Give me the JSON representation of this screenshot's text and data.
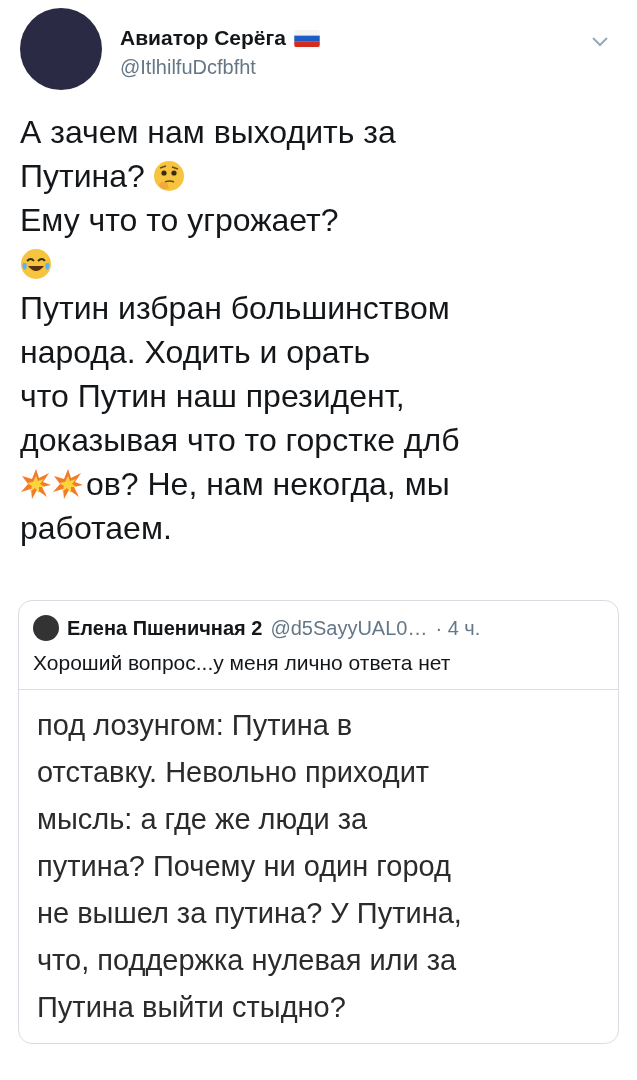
{
  "author": {
    "name": "Авиатор Серёга",
    "handle": "@ItlhilfuDcfbfht"
  },
  "body": [
    [
      {
        "kind": "text",
        "text": "А зачем нам выходить за"
      }
    ],
    [
      {
        "kind": "text",
        "text": "Путина?"
      },
      {
        "kind": "thinking"
      }
    ],
    [
      {
        "kind": "text",
        "text": "Ему что то угрожает?"
      }
    ],
    [
      {
        "kind": "joy"
      }
    ],
    [
      {
        "kind": "text",
        "text": "Путин избран большинством"
      }
    ],
    [
      {
        "kind": "text",
        "text": "народа. Ходить и орать"
      }
    ],
    [
      {
        "kind": "text",
        "text": "что Путин наш президент,"
      }
    ],
    [
      {
        "kind": "text",
        "text": "доказывая что то горстке длб"
      }
    ],
    [
      {
        "kind": "collision"
      },
      {
        "kind": "collision"
      },
      {
        "kind": "text",
        "text": "ов? Не, нам некогда, мы"
      }
    ],
    [
      {
        "kind": "text",
        "text": "работаем."
      }
    ]
  ],
  "quote": {
    "name": "Елена Пшеничная 2",
    "handle": "@d5SayyUAL0…",
    "time": "· 4 ч.",
    "text": "Хороший вопрос...у меня лично ответа нет",
    "image_lines": [
      "под лозунгом: Путина в",
      "отставку. Невольно приходит",
      "мысль: а где же люди за",
      "путина? Почему ни один город",
      "не вышел за путина? У Путина,",
      "что, поддержка нулевая или за",
      "Путина выйти стыдно?"
    ]
  }
}
